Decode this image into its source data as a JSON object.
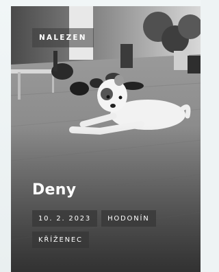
{
  "card": {
    "status": "NALEZEN",
    "name": "Deny",
    "tags": {
      "date": "10. 2. 2023",
      "location": "HODONÍN",
      "breed": "KŘÍŽENEC"
    },
    "image": "dog-lying-on-floor-photo"
  }
}
